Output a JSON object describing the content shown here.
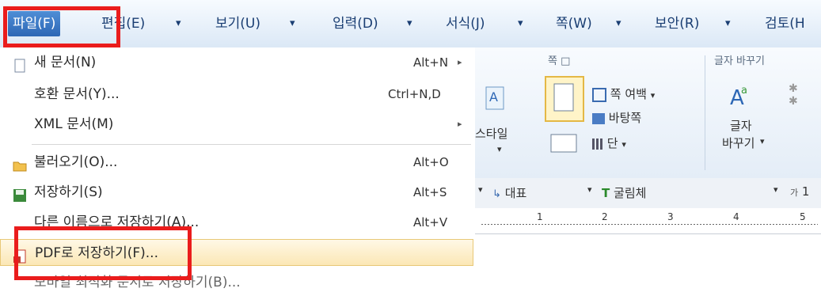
{
  "menubar": {
    "file": "파일(F)",
    "edit": "편집(E)",
    "view": "보기(U)",
    "input": "입력(D)",
    "format": "서식(J)",
    "page": "쪽(W)",
    "security": "보안(R)",
    "review": "검토(H"
  },
  "file_menu": {
    "new_doc": {
      "label": "새 문서(N)",
      "shortcut": "Alt+N"
    },
    "compat_doc": {
      "label": "호환 문서(Y)...",
      "shortcut": "Ctrl+N,D"
    },
    "xml_doc": {
      "label": "XML 문서(M)"
    },
    "open": {
      "label": "불러오기(O)...",
      "shortcut": "Alt+O"
    },
    "save": {
      "label": "저장하기(S)",
      "shortcut": "Alt+S"
    },
    "save_as": {
      "label": "다른 이름으로 저장하기(A)...",
      "shortcut": "Alt+V"
    },
    "save_pdf": {
      "label": "PDF로 저장하기(F)..."
    },
    "save_mobile": {
      "label": "모바일 최적화 문서로 저장하기(B)..."
    }
  },
  "ribbon": {
    "page_group": "쪽 □",
    "margin": "쪽 여백",
    "background": "바탕쪽",
    "column": "단",
    "style": "스타일",
    "char_group": "글자 바꾸기",
    "char_line1": "글자",
    "char_line2": "바꾸기"
  },
  "format_bar": {
    "style_value": "대표",
    "font_value": "굴림체",
    "size_value": "1"
  },
  "ruler": {
    "ticks": [
      "1",
      "2",
      "3",
      "4",
      "5"
    ]
  },
  "colors": {
    "highlight": "#fbe7b5",
    "menu_active": "#2d67b5",
    "annotation": "#ea1c1c"
  }
}
